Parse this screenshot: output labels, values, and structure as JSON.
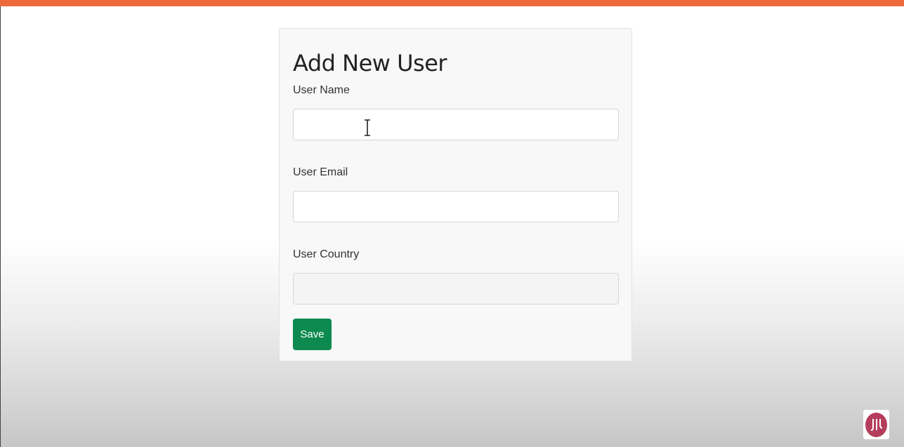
{
  "form": {
    "title": "Add New User",
    "fields": [
      {
        "label": "User Name",
        "value": "",
        "placeholder": ""
      },
      {
        "label": "User Email",
        "value": "",
        "placeholder": ""
      },
      {
        "label": "User Country",
        "value": "",
        "placeholder": ""
      }
    ],
    "save_label": "Save"
  },
  "colors": {
    "accent_bar": "#ec6a3e",
    "save_button": "#0d8a4f",
    "logo": "#b53d5c"
  },
  "icons": {
    "cursor": "text-cursor-icon",
    "logo": "channel-logo-icon"
  }
}
